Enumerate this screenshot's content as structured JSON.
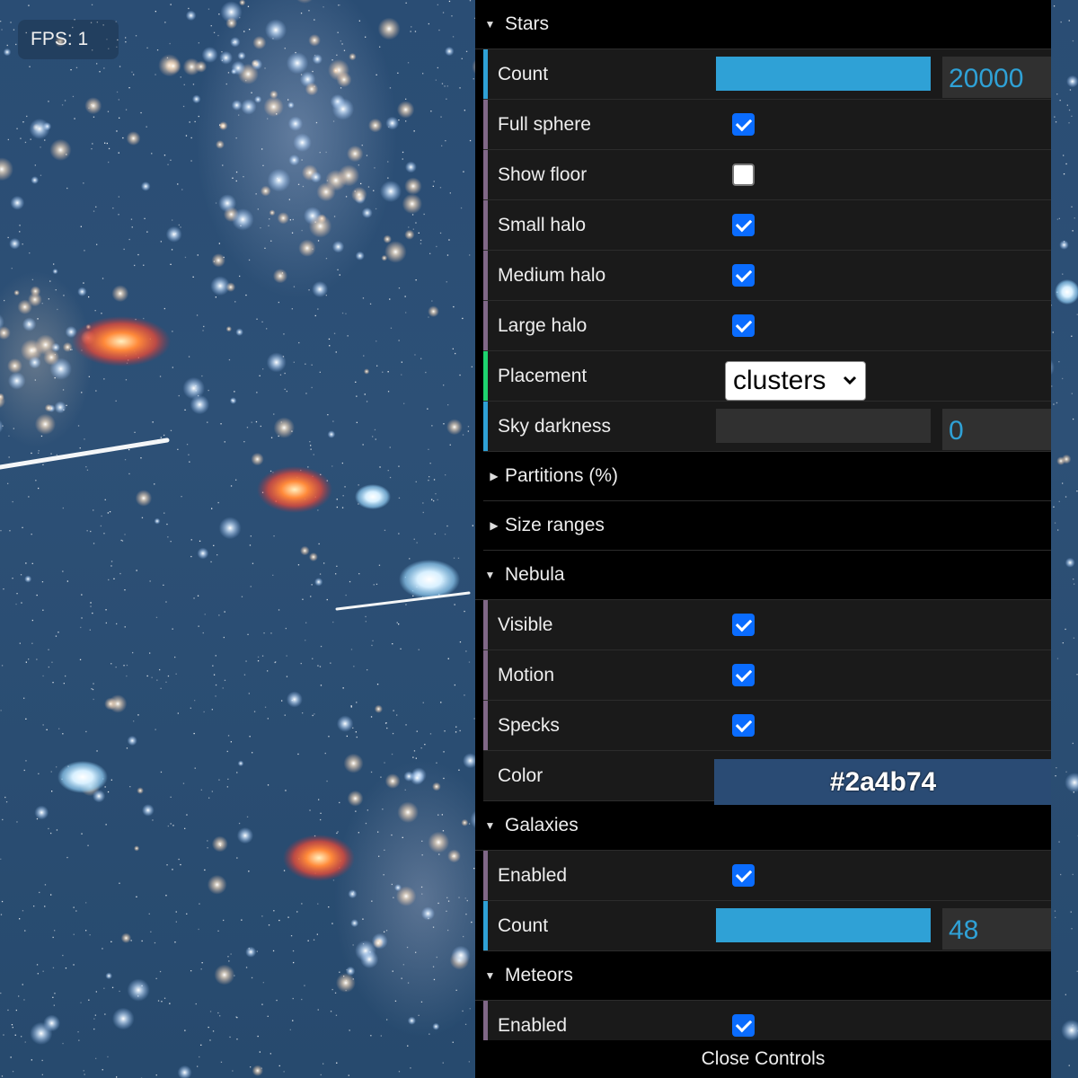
{
  "fps": {
    "label": "FPS: 1"
  },
  "stars": {
    "title": "Stars",
    "count": {
      "label": "Count",
      "value": "20000",
      "fill_fraction": 1.0
    },
    "full_sphere": {
      "label": "Full sphere",
      "checked": true
    },
    "show_floor": {
      "label": "Show floor",
      "checked": false
    },
    "small_halo": {
      "label": "Small halo",
      "checked": true
    },
    "medium_halo": {
      "label": "Medium halo",
      "checked": true
    },
    "large_halo": {
      "label": "Large halo",
      "checked": true
    },
    "placement": {
      "label": "Placement",
      "value": "clusters"
    },
    "sky_darkness": {
      "label": "Sky darkness",
      "value": "0",
      "fill_fraction": 0.0
    },
    "partitions": {
      "title": "Partitions (%)"
    },
    "size_ranges": {
      "title": "Size ranges"
    }
  },
  "nebula": {
    "title": "Nebula",
    "visible": {
      "label": "Visible",
      "checked": true
    },
    "motion": {
      "label": "Motion",
      "checked": true
    },
    "specks": {
      "label": "Specks",
      "checked": true
    },
    "color": {
      "label": "Color",
      "value": "#2a4b74"
    }
  },
  "galaxies": {
    "title": "Galaxies",
    "enabled": {
      "label": "Enabled",
      "checked": true
    },
    "count": {
      "label": "Count",
      "value": "48",
      "fill_fraction": 1.0
    }
  },
  "meteors": {
    "title": "Meteors",
    "enabled": {
      "label": "Enabled",
      "checked": true
    }
  },
  "close_controls": {
    "label": "Close Controls"
  },
  "colors": {
    "slider_accent": "#2fa1d6",
    "number_stripe": "#2fa1d6",
    "boolean_stripe": "#806787",
    "option_stripe": "#1ed36f",
    "nebula_color": "#2a4b74"
  }
}
